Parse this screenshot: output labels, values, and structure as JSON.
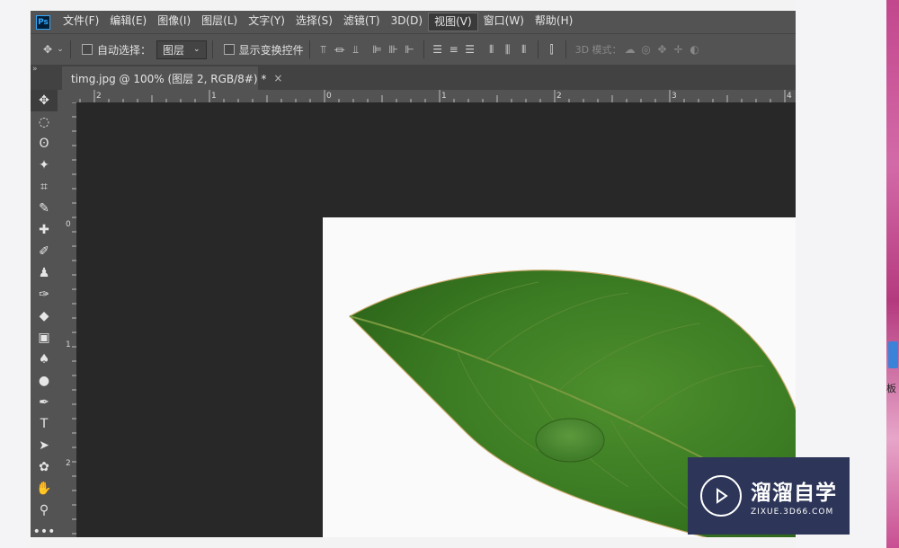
{
  "app": {
    "logo_text": "Ps"
  },
  "menu": [
    {
      "label": "文件(F)"
    },
    {
      "label": "编辑(E)"
    },
    {
      "label": "图像(I)"
    },
    {
      "label": "图层(L)"
    },
    {
      "label": "文字(Y)"
    },
    {
      "label": "选择(S)"
    },
    {
      "label": "滤镜(T)"
    },
    {
      "label": "3D(D)"
    },
    {
      "label": "视图(V)",
      "active": true
    },
    {
      "label": "窗口(W)"
    },
    {
      "label": "帮助(H)"
    }
  ],
  "options": {
    "auto_select_label": "自动选择：",
    "auto_select_value": "图层",
    "show_transform_label": "显示变换控件",
    "mode3d_label": "3D 模式："
  },
  "document": {
    "tab_title": "timg.jpg @ 100% (图层 2, RGB/8#) *",
    "close_symbol": "×"
  },
  "ruler": {
    "top_labels": [
      "2",
      "1",
      "0",
      "1",
      "2",
      "3",
      "4"
    ],
    "left_labels": [
      "0",
      "1",
      "2"
    ]
  },
  "tools": [
    {
      "name": "move-tool",
      "glyph": "✥"
    },
    {
      "name": "marquee-tool",
      "glyph": "◌"
    },
    {
      "name": "lasso-tool",
      "glyph": "ʘ"
    },
    {
      "name": "magic-wand-tool",
      "glyph": "✦"
    },
    {
      "name": "crop-tool",
      "glyph": "⌗"
    },
    {
      "name": "eyedropper-tool",
      "glyph": "✎"
    },
    {
      "name": "healing-brush-tool",
      "glyph": "✚"
    },
    {
      "name": "brush-tool",
      "glyph": "✐"
    },
    {
      "name": "stamp-tool",
      "glyph": "♟"
    },
    {
      "name": "history-brush-tool",
      "glyph": "✑"
    },
    {
      "name": "eraser-tool",
      "glyph": "◆"
    },
    {
      "name": "gradient-tool",
      "glyph": "▣"
    },
    {
      "name": "blur-tool",
      "glyph": "♠"
    },
    {
      "name": "dodge-tool",
      "glyph": "●"
    },
    {
      "name": "pen-tool",
      "glyph": "✒"
    },
    {
      "name": "type-tool",
      "glyph": "T"
    },
    {
      "name": "path-selection-tool",
      "glyph": "➤"
    },
    {
      "name": "shape-tool",
      "glyph": "✿"
    },
    {
      "name": "hand-tool",
      "glyph": "✋"
    },
    {
      "name": "zoom-tool",
      "glyph": "⚲"
    },
    {
      "name": "more-tools",
      "glyph": "•••"
    }
  ],
  "watermark": {
    "title": "溜溜自学",
    "subtitle": "ZIXUE.3D66.COM"
  },
  "desktop": {
    "side_char": "板"
  },
  "colors": {
    "leaf": "#3a7a22",
    "leaf_dark": "#2c6419",
    "ps_panel": "#535353",
    "canvas_bg": "#282828",
    "watermark_bg": "#2d3658"
  }
}
